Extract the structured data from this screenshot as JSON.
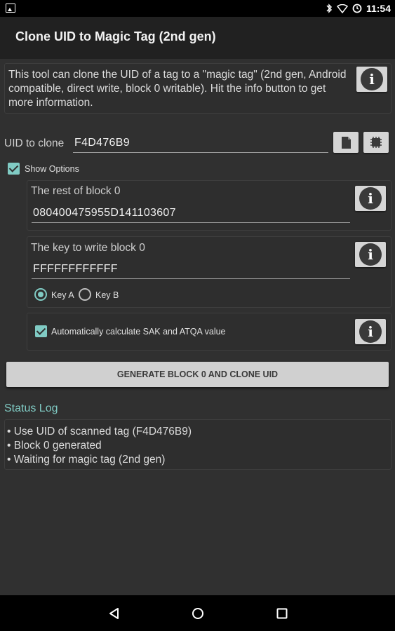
{
  "status_bar": {
    "time": "11:54"
  },
  "app_bar": {
    "title": "Clone UID to Magic Tag (2nd gen)"
  },
  "intro": {
    "text": "This tool can clone the UID of a tag to a \"magic tag\" (2nd gen, Android compatible, direct write, block 0 writable). Hit the info button to get more information."
  },
  "uid": {
    "label": "UID to clone",
    "value": "F4D476B9"
  },
  "show_options": {
    "label": "Show Options",
    "checked": true
  },
  "rest_block0": {
    "label": "The rest of block 0",
    "value": "080400475955D141103607"
  },
  "key_block0": {
    "label": "The key to write block 0",
    "value": "FFFFFFFFFFFF",
    "options": [
      "Key A",
      "Key B"
    ],
    "selected": "Key A"
  },
  "auto_calc": {
    "label": "Automatically calculate SAK and ATQA value",
    "checked": true
  },
  "generate_button": {
    "label": "GENERATE BLOCK 0 AND CLONE UID"
  },
  "status_log": {
    "title": "Status Log",
    "lines": [
      "• Use UID of scanned tag (F4D476B9)",
      "• Block 0 generated",
      "• Waiting for magic tag (2nd gen)"
    ]
  },
  "colors": {
    "accent": "#80cbc4",
    "background": "#303030",
    "app_bar": "#212121"
  },
  "icons": [
    "info-icon",
    "paste-icon",
    "nfc-chip-icon",
    "back-icon",
    "home-icon",
    "recents-icon",
    "bluetooth-icon",
    "wifi-icon",
    "alarm-icon",
    "image-icon"
  ]
}
